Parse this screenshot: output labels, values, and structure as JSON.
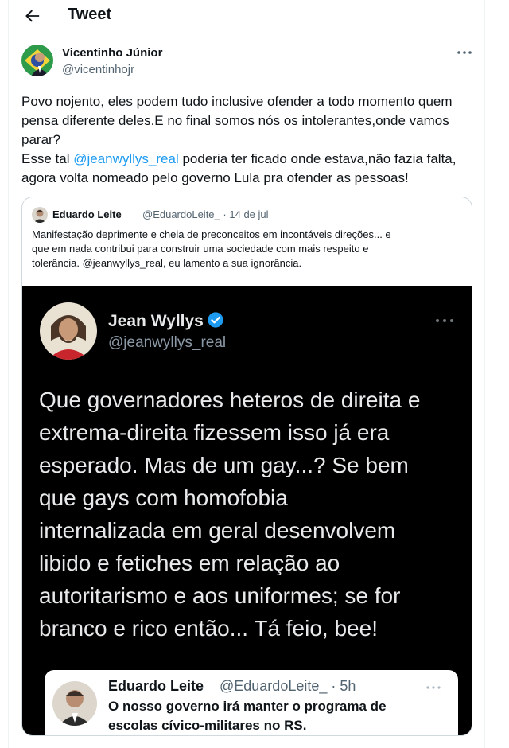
{
  "header": {
    "back_icon": "arrow-left-icon",
    "title": "Tweet"
  },
  "tweet": {
    "author": {
      "name": "Vicentinho Júnior",
      "handle": "@vicentinhojr"
    },
    "more_icon": "more-icon",
    "lines": [
      "Povo nojento, eles podem tudo inclusive ofender a todo momento quem",
      "pensa diferente deles.E no final somos nós os intolerantes,onde vamos",
      "parar?"
    ],
    "line4": {
      "before": "Esse tal ",
      "mention": "@jeanwyllys_real",
      "after": " poderia ter ficado onde estava,não fazia falta,"
    },
    "line5": "agora volta nomeado pelo governo Lula pra ofender as pessoas!"
  },
  "quote": {
    "author": "Eduardo Leite",
    "handle": "@EduardoLeite_",
    "separator": "·",
    "date": "14 de jul",
    "lines": [
      "Manifestação deprimente e cheia de preconceitos em incontáveis direções... e",
      "que em nada contribui para construir uma sociedade com mais respeito e",
      "tolerância.  @jeanwyllys_real, eu lamento a sua ignorância."
    ]
  },
  "screenshot": {
    "name": "Jean Wyllys",
    "verified_icon": "verified-badge-icon",
    "handle": "@jeanwyllys_real",
    "lines": [
      "Que governadores heteros de direita e",
      "extrema-direita fizessem isso já era",
      "esperado. Mas de um gay...? Se bem",
      "que gays com homofobia",
      "internalizada em geral desenvolvem",
      "libido e fetiches em relação ao",
      "autoritarismo e aos uniformes; se for",
      "branco e rico então... Tá feio, bee!"
    ],
    "inner": {
      "name": "Eduardo Leite",
      "handle": "@EduardoLeite_",
      "time": "· 5h",
      "lines": [
        "O nosso governo irá manter o programa de",
        "escolas cívico-militares no RS."
      ]
    }
  },
  "colors": {
    "link": "#1d9bf0",
    "secondary_text": "#536471",
    "screenshot_bg": "#000000",
    "verified": "#1d9bf0"
  }
}
